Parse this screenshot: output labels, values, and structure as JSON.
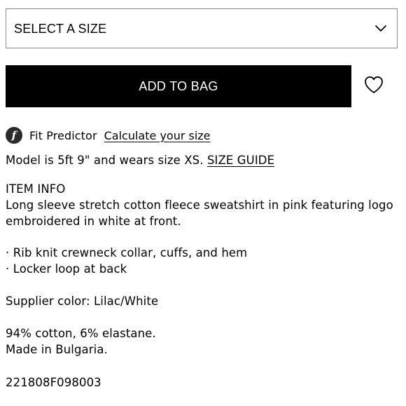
{
  "size_select": {
    "value": "SELECT A SIZE"
  },
  "actions": {
    "add_to_bag_label": "ADD TO BAG"
  },
  "fit_predictor": {
    "logo_letter": "f",
    "title": "Fit Predictor",
    "link": "Calculate your size"
  },
  "model_info": {
    "text": "Model is 5ft 9\" and wears size XS.",
    "size_guide_link": "SIZE GUIDE"
  },
  "item_info": {
    "heading": "ITEM INFO",
    "description_line1": "Long sleeve stretch cotton fleece sweatshirt in pink featuring logo",
    "description_line2": "embroidered in white at front.",
    "bullets": [
      "· Rib knit crewneck collar, cuffs, and hem",
      "· Locker loop at back"
    ],
    "supplier_color": "Supplier color: Lilac/White",
    "composition": "94% cotton, 6% elastane.",
    "origin": "Made in Bulgaria.",
    "sku": "221808F098003"
  },
  "icons": {
    "select_arrow": "chevron-down-icon",
    "wishlist": "heart-icon",
    "fit_predictor": "fit-predictor-logo-icon"
  }
}
